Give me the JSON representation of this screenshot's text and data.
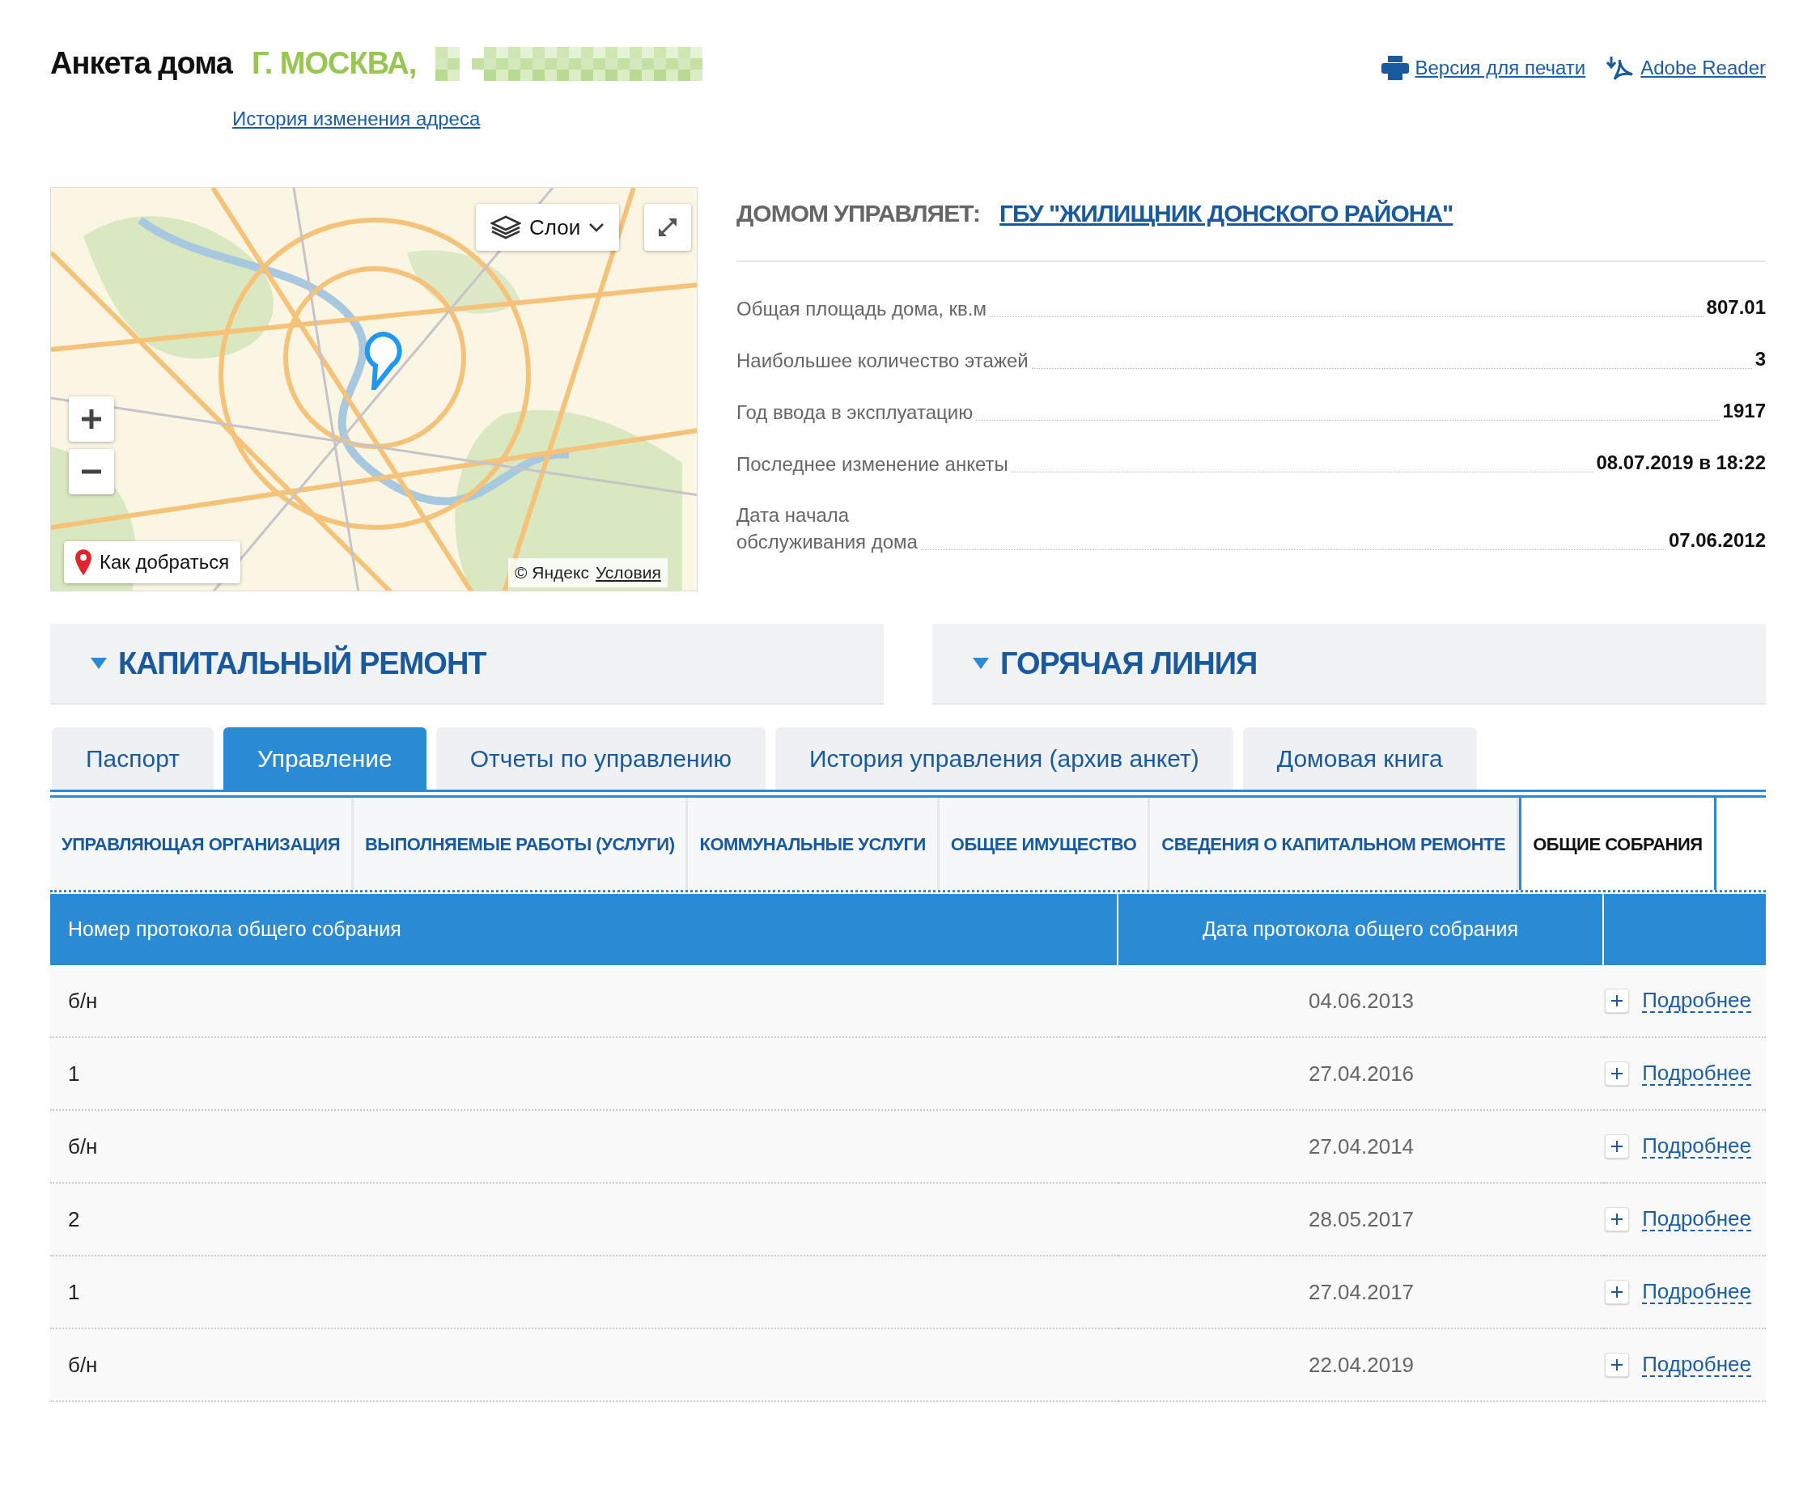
{
  "header": {
    "title": "Анкета дома",
    "address": "Г. МОСКВА,",
    "history_link": "История изменения адреса",
    "links": [
      {
        "kind": "print",
        "label": "Версия для печати"
      },
      {
        "kind": "pdf",
        "label": "Adobe Reader"
      }
    ]
  },
  "map": {
    "layers_button": "Слои",
    "route_button": "Как добраться",
    "copyright": "© Яндекс",
    "terms_link": "Условия"
  },
  "management": {
    "label": "ДОМОМ УПРАВЛЯЕТ:",
    "company": "ГБУ \"ЖИЛИЩНИК ДОНСКОГО РАЙОНА\""
  },
  "facts": [
    {
      "label": "Общая площадь дома, кв.м",
      "value": "807.01"
    },
    {
      "label": "Наибольшее количество этажей",
      "value": "3"
    },
    {
      "label": "Год ввода в эксплуатацию",
      "value": "1917"
    },
    {
      "label": "Последнее изменение анкеты",
      "value": "08.07.2019 в 18:22"
    },
    {
      "label": "Дата начала\nобслуживания дома",
      "value": "07.06.2012"
    }
  ],
  "panels": [
    {
      "title": "КАПИТАЛЬНЫЙ РЕМОНТ"
    },
    {
      "title": "ГОРЯЧАЯ ЛИНИЯ"
    }
  ],
  "tabs": [
    {
      "label": "Паспорт",
      "selected": false
    },
    {
      "label": "Управление",
      "selected": true
    },
    {
      "label": "Отчеты по управлению",
      "selected": false
    },
    {
      "label": "История управления (архив анкет)",
      "selected": false
    },
    {
      "label": "Домовая книга",
      "selected": false
    }
  ],
  "subtabs": [
    {
      "label": "УПРАВЛЯЮЩАЯ ОРГАНИЗАЦИЯ",
      "selected": false
    },
    {
      "label": "ВЫПОЛНЯЕМЫЕ РАБОТЫ (УСЛУГИ)",
      "selected": false
    },
    {
      "label": "КОММУНАЛЬНЫЕ УСЛУГИ",
      "selected": false
    },
    {
      "label": "ОБЩЕЕ ИМУЩЕСТВО",
      "selected": false
    },
    {
      "label": "СВЕДЕНИЯ О КАПИТАЛЬНОМ РЕМОНТЕ",
      "selected": false
    },
    {
      "label": "ОБЩИЕ СОБРАНИЯ",
      "selected": true
    }
  ],
  "table": {
    "columns": [
      "Номер протокола общего собрания",
      "Дата протокола общего собрания"
    ],
    "rows": [
      {
        "number": "б/н",
        "date": "04.06.2013",
        "details": "Подробнее"
      },
      {
        "number": "1",
        "date": "27.04.2016",
        "details": "Подробнее"
      },
      {
        "number": "б/н",
        "date": "27.04.2014",
        "details": "Подробнее"
      },
      {
        "number": "2",
        "date": "28.05.2017",
        "details": "Подробнее"
      },
      {
        "number": "1",
        "date": "27.04.2017",
        "details": "Подробнее"
      },
      {
        "number": "б/н",
        "date": "22.04.2019",
        "details": "Подробнее"
      }
    ]
  }
}
